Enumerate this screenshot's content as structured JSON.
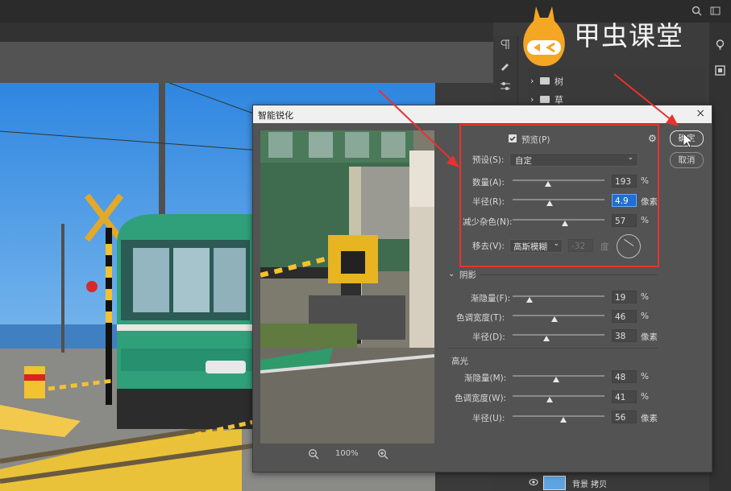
{
  "logo": {
    "text": "甲虫课堂"
  },
  "layers": [
    {
      "name": "树"
    },
    {
      "name": "草"
    },
    {
      "name": "背景 拷贝"
    }
  ],
  "dialog": {
    "title": "智能锐化",
    "preview_label": "预览(P)",
    "preset_label": "预设(S):",
    "preset_value": "自定",
    "amount_label": "数量(A):",
    "amount_value": "193",
    "amount_unit": "%",
    "radius_label": "半径(R):",
    "radius_value": "4.9",
    "radius_unit": "像素",
    "noise_label": "减少杂色(N):",
    "noise_value": "57",
    "noise_unit": "%",
    "remove_label": "移去(V):",
    "remove_value": "高斯模糊",
    "angle_value": "-32",
    "angle_unit": "度",
    "ok_label": "确定",
    "cancel_label": "取消",
    "shadow_section": "阴影",
    "shadow_fade_label": "渐隐量(F):",
    "shadow_fade_value": "19",
    "shadow_fade_unit": "%",
    "shadow_tonal_label": "色调宽度(T):",
    "shadow_tonal_value": "46",
    "shadow_tonal_unit": "%",
    "shadow_radius_label": "半径(D):",
    "shadow_radius_value": "38",
    "shadow_radius_unit": "像素",
    "highlight_section": "高光",
    "hl_fade_label": "渐隐量(M):",
    "hl_fade_value": "48",
    "hl_fade_unit": "%",
    "hl_tonal_label": "色调宽度(W):",
    "hl_tonal_value": "41",
    "hl_tonal_unit": "%",
    "hl_radius_label": "半径(U):",
    "hl_radius_value": "56",
    "hl_radius_unit": "像素",
    "zoom_value": "100%"
  },
  "colors": {
    "annotation": "#e8322f",
    "accent": "#1f6fd1"
  }
}
